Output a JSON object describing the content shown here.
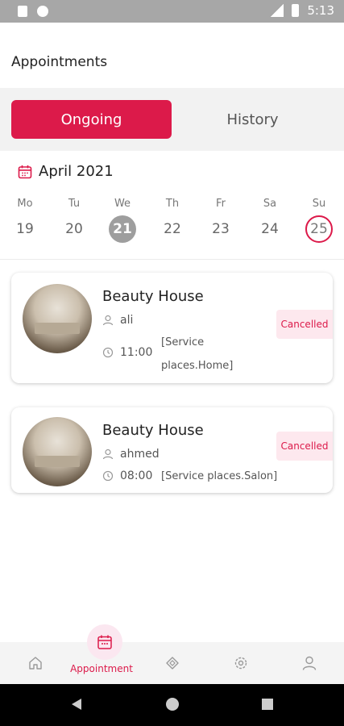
{
  "status_bar": {
    "time": "5:13"
  },
  "header": {
    "title": "Appointments"
  },
  "tabs": [
    {
      "label": "Ongoing",
      "active": true
    },
    {
      "label": "History",
      "active": false
    }
  ],
  "calendar": {
    "month": "April 2021",
    "days": [
      {
        "name": "Mo",
        "date": "19"
      },
      {
        "name": "Tu",
        "date": "20"
      },
      {
        "name": "We",
        "date": "21",
        "state": "today"
      },
      {
        "name": "Th",
        "date": "22"
      },
      {
        "name": "Fr",
        "date": "23"
      },
      {
        "name": "Sa",
        "date": "24"
      },
      {
        "name": "Su",
        "date": "25",
        "state": "selected"
      }
    ]
  },
  "appointments": [
    {
      "shop": "Beauty House",
      "client": "ali",
      "time": "11:00",
      "service": "[Service places.Home]",
      "status": "Cancelled"
    },
    {
      "shop": "Beauty House",
      "client": "ahmed",
      "time": "08:00",
      "service": "[Service places.Salon]",
      "status": "Cancelled"
    }
  ],
  "bottom_nav": {
    "active_label": "Appointment",
    "icons": [
      "home-icon",
      "appointment-icon",
      "services-icon",
      "settings-icon",
      "profile-icon"
    ]
  },
  "colors": {
    "accent": "#dc1a4a",
    "badge_bg": "#fde8ee",
    "today": "#9e9e9e"
  }
}
